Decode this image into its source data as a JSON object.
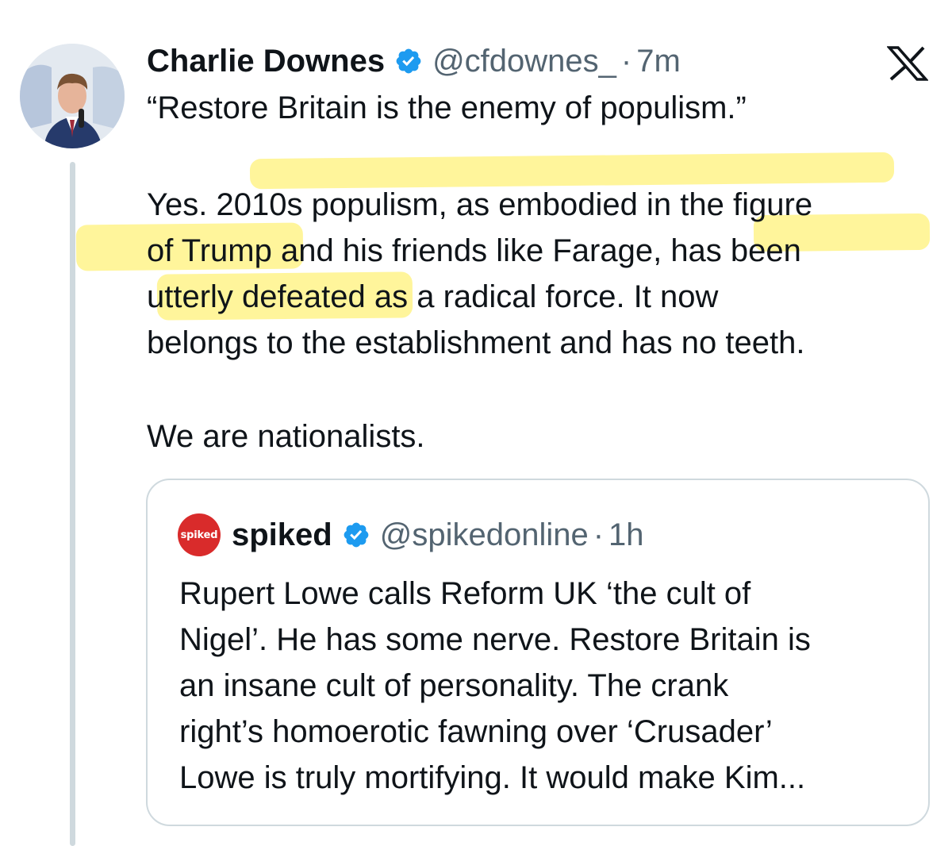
{
  "tweet": {
    "author_name": "Charlie Downes",
    "handle": "@cfdownes_",
    "separator": "·",
    "time": "7m",
    "lines": [
      "“Restore Britain is the enemy of populism.”",
      "",
      "Yes. 2010s populism, as embodied in the figure",
      "of Trump and his friends like Farage, has been",
      "utterly defeated as a radical force. It now",
      "belongs to the establishment and has no teeth.",
      "",
      "We are nationalists."
    ]
  },
  "quoted_tweet": {
    "avatar_text": "spiked",
    "author_name": "spiked",
    "handle": "@spikedonline",
    "separator": "·",
    "time": "1h",
    "lines": [
      "Rupert Lowe calls Reform UK ‘the cult of",
      "Nigel’. He has some nerve. Restore Britain is",
      "an insane cult of personality. The crank",
      "right’s homoerotic fawning over ‘Crusader’",
      "Lowe is truly mortifying. It would make Kim..."
    ]
  },
  "icons": {
    "verified": "verified-badge-icon",
    "platform": "x-logo-icon"
  },
  "colors": {
    "verified_blue": "#1d9bf0",
    "highlight": "#fff27a",
    "secondary_text": "#536471",
    "spiked_red": "#d92b2b"
  }
}
